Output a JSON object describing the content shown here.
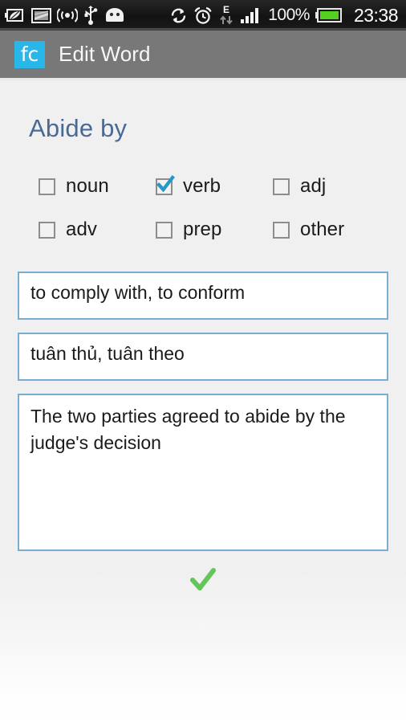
{
  "statusbar": {
    "icons_left": [
      {
        "name": "battery-saver-leaf-icon",
        "label": "battery saver"
      },
      {
        "name": "screenshot-icon",
        "label": "screenshot captured"
      },
      {
        "name": "wifi-hotspot-icon",
        "label": "hotspot active"
      },
      {
        "name": "usb-icon",
        "label": "usb connected"
      },
      {
        "name": "android-robot-icon",
        "label": "android"
      }
    ],
    "icons_right": [
      {
        "name": "sync-icon",
        "label": "syncing"
      },
      {
        "name": "alarm-clock-icon",
        "label": "alarm set"
      },
      {
        "name": "edge-data-icon",
        "label": "E"
      },
      {
        "name": "signal-bars-icon",
        "label": "signal"
      }
    ],
    "battery_percent": "100%",
    "battery_icon": "battery-full-icon",
    "clock": "23:38"
  },
  "appbar": {
    "icon_text": "fc",
    "icon_name": "app-logo-icon",
    "title": "Edit Word",
    "background": "#787878",
    "icon_background": "#29b6e8"
  },
  "main": {
    "word": "Abide by",
    "word_color": "#4a6a96",
    "accent_checkbox": "#2797c6",
    "field_border": "#79aece",
    "part_of_speech": [
      {
        "label": "noun",
        "checked": false
      },
      {
        "label": "verb",
        "checked": true
      },
      {
        "label": "adj",
        "checked": false
      },
      {
        "label": "adv",
        "checked": false
      },
      {
        "label": "prep",
        "checked": false
      },
      {
        "label": "other",
        "checked": false
      }
    ],
    "fields": {
      "definition": "to comply with, to conform",
      "translation": "tuân thủ, tuân theo",
      "example": "The two parties agreed to abide by the judge's decision"
    },
    "confirm": {
      "name": "save-check-icon",
      "color": "#6cc martian"
    }
  }
}
